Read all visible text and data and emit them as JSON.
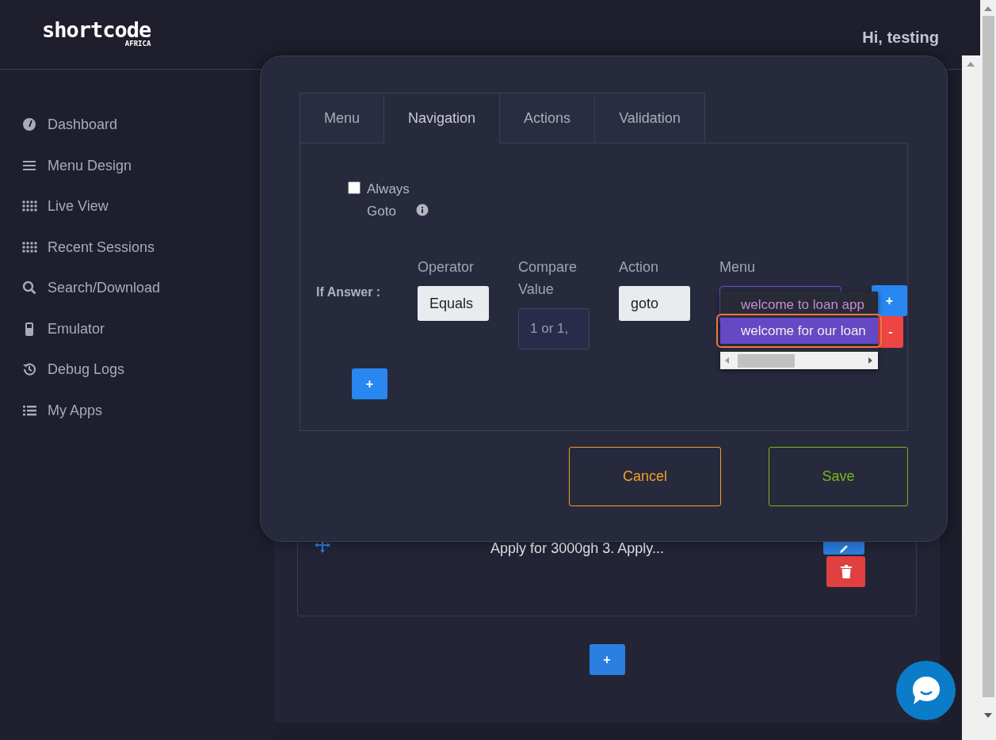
{
  "header": {
    "logo": "shortcode",
    "logo_sub": "AFRICA",
    "greeting": "Hi, testing"
  },
  "sidebar": {
    "items": [
      {
        "label": "Dashboard",
        "kind": "gauge"
      },
      {
        "label": "Menu Design",
        "kind": "bars"
      },
      {
        "label": "Live View",
        "kind": "dots"
      },
      {
        "label": "Recent Sessions",
        "kind": "dots"
      },
      {
        "label": "Search/Download",
        "kind": "search"
      },
      {
        "label": "Emulator",
        "kind": "phone"
      },
      {
        "label": "Debug Logs",
        "kind": "history"
      },
      {
        "label": "My Apps",
        "kind": "list"
      }
    ]
  },
  "background_card": {
    "text": "Apply for 3000gh 3. Apply..."
  },
  "add_menu_label": "+",
  "modal": {
    "tabs": [
      {
        "label": "Menu",
        "selected": false
      },
      {
        "label": "Navigation",
        "selected": true
      },
      {
        "label": "Actions",
        "selected": false
      },
      {
        "label": "Validation",
        "selected": false
      }
    ],
    "always_goto": {
      "label": "Always Goto",
      "checked": false
    },
    "condition": {
      "label": "If Answer :",
      "operator": {
        "label": "Operator",
        "value": "Equals"
      },
      "compare": {
        "label": "Compare Value",
        "placeholder": "1 or 1,"
      },
      "action": {
        "label": "Action",
        "value": "goto"
      },
      "menu": {
        "label": "Menu",
        "options": [
          {
            "label": "welcome to loan app",
            "selected": false
          },
          {
            "label": "welcome for our loan",
            "selected": true
          }
        ]
      },
      "add_label": "+",
      "remove_label": "-"
    },
    "add_condition_label": "+",
    "buttons": [
      {
        "label": "Cancel",
        "kind": "cancel"
      },
      {
        "label": "Save",
        "kind": "save"
      }
    ]
  }
}
